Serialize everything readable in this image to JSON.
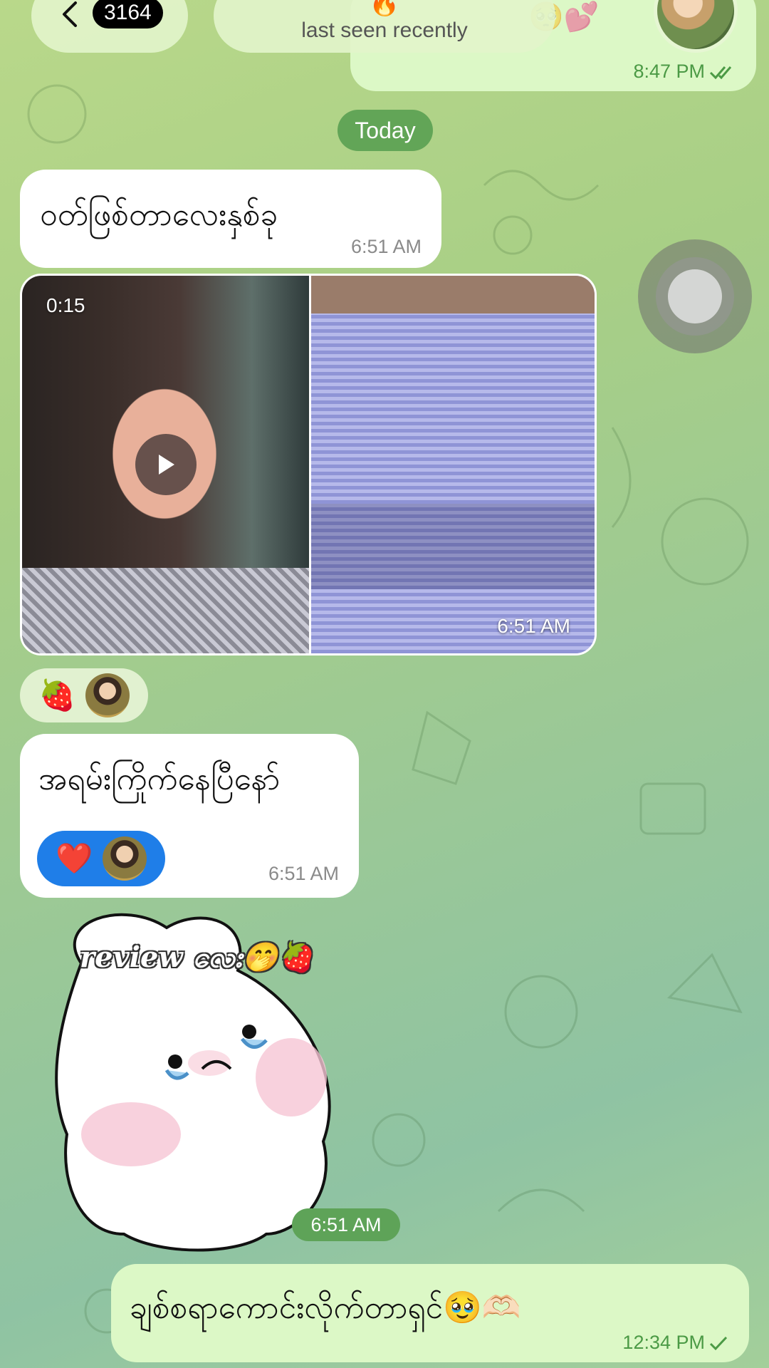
{
  "header": {
    "unread_count": "3164",
    "status_emoji": "🔥",
    "status": "last seen recently"
  },
  "messages": {
    "top_outgoing": {
      "emojis": "🥺💕",
      "time": "8:47 PM"
    },
    "day_separator": "Today",
    "msg1": {
      "text": "ဝတ်ဖြစ်တာလေးနှစ်ခု",
      "time": "6:51 AM"
    },
    "media": {
      "duration": "0:15",
      "time": "6:51 AM",
      "reaction_emoji": "🍓"
    },
    "msg2": {
      "text": "အရမ်းကြိုက်နေပြီနော်",
      "time": "6:51 AM",
      "reaction_emoji": "❤️"
    },
    "sticker": {
      "caption": "review လေး🤭🍓",
      "time": "6:51 AM"
    },
    "bottom_outgoing": {
      "text": "ချစ်စရာကောင်းလိုက်တာရှင်🥹🫶🏻",
      "time": "12:34 PM"
    }
  },
  "colors": {
    "outgoing_bubble": "#dcf8c6",
    "incoming_bubble": "#ffffff",
    "accent_green": "#62a557",
    "reaction_blue": "#1f7ee8"
  }
}
